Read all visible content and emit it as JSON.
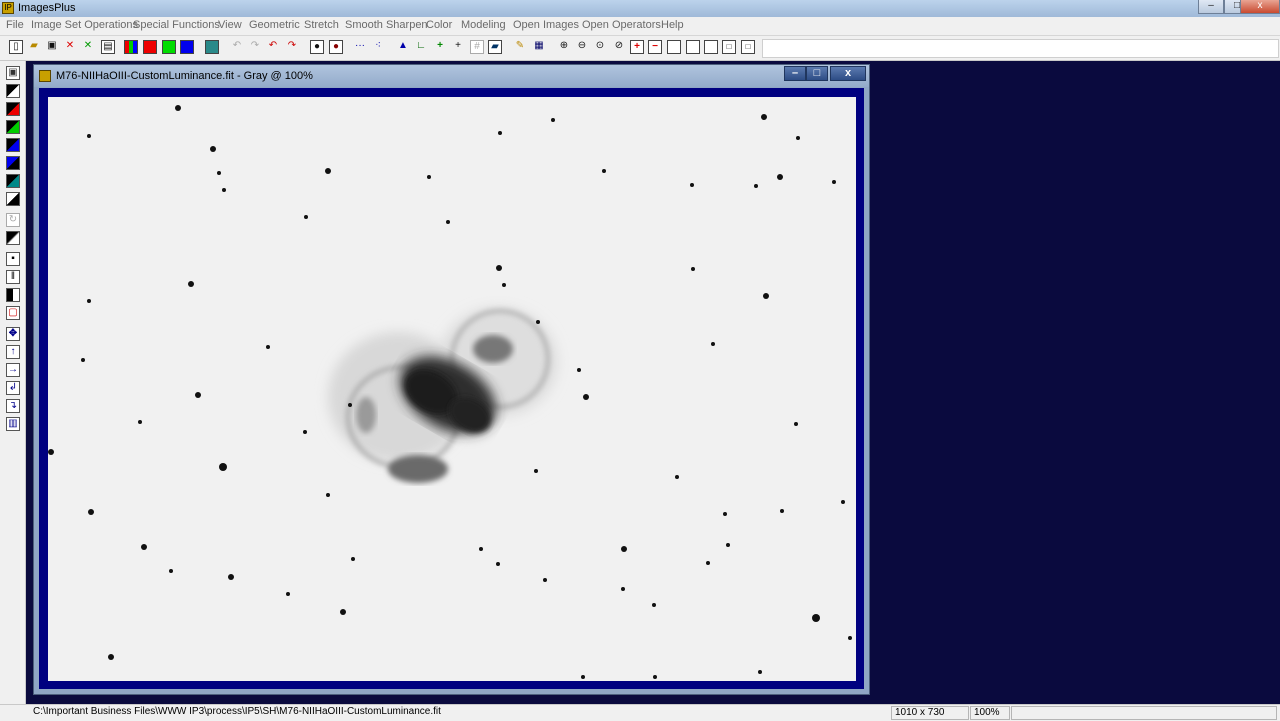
{
  "app": {
    "title": "ImagesPlus",
    "minimize": "–",
    "maximize": "□",
    "close": "x"
  },
  "menu": [
    "File",
    "Image Set Operations",
    "Special Functions",
    "View",
    "Geometric",
    "Stretch",
    "Smooth Sharpen",
    "Color",
    "Modeling",
    "Open Images",
    "Open Operators",
    "Help"
  ],
  "image_window": {
    "title": "M76-NIIHaOIII-CustomLuminance.fit - Gray @ 100%",
    "minimize": "–",
    "maximize": "□",
    "close": "x"
  },
  "status": {
    "path": "C:\\Important Business Files\\WWW IP3\\process\\IP5\\SH\\M76-NIIHaOIII-CustomLuminance.fit",
    "dimensions": "1010 x 730",
    "zoom": "100%"
  },
  "icons": {
    "toolbar": [
      "new-file-icon",
      "open-file-icon",
      "save-icon",
      "close-red-icon",
      "close-green-icon",
      "copy-icon",
      "rgb-channels-icon",
      "red-channel-icon",
      "green-channel-icon",
      "blue-channel-icon",
      "grid-icon",
      "undo-icon",
      "redo-icon",
      "undo-red-icon",
      "redo-red-icon",
      "ellipse-select-icon",
      "circle-select-icon",
      "line-dotted-icon",
      "dots-icon",
      "histogram-icon",
      "axes-icon",
      "crosshair-plus-icon",
      "crosshair-icon",
      "grid-light-icon",
      "image-adjust-icon",
      "pencil-icon",
      "table-grid-icon",
      "zoom-in-icon",
      "zoom-out-icon",
      "zoom-fit-icon",
      "zoom-reset-icon",
      "add-red-icon",
      "remove-red-icon",
      "frame-1-icon",
      "frame-2-icon",
      "frame-3-icon",
      "frame-4-icon",
      "frame-5-icon"
    ],
    "left": [
      "save-icon",
      "black-square-icon",
      "red-black-icon",
      "green-black-icon",
      "blue-black-icon",
      "black-blue-icon",
      "black-square-2-icon",
      "black-white-icon",
      "rotate-icon",
      "diagonal-icon",
      "center-square-icon",
      "columns-icon",
      "black-bar-icon",
      "crop-icon",
      "move-icon",
      "arrow-up-icon",
      "arrow-right-icon",
      "arrow-back-icon",
      "arrow-down-icon",
      "frame-icon"
    ]
  }
}
